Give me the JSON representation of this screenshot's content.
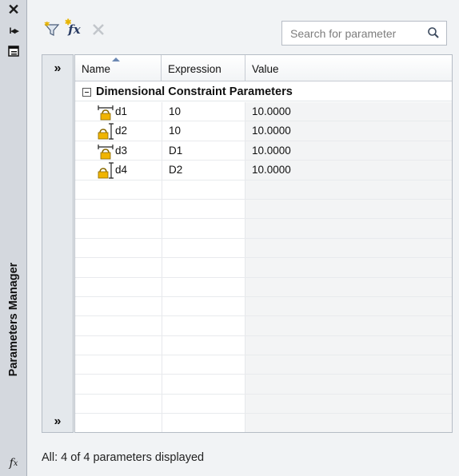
{
  "palette": {
    "title_text": "Parameters Manager"
  },
  "toolbar": {
    "filter_icon": "filter-icon",
    "fx_label": "fx",
    "delete_icon": "delete-icon",
    "search_placeholder": "Search for parameter"
  },
  "grid": {
    "columns": [
      "Name",
      "Expression",
      "Value"
    ],
    "group_label": "Dimensional Constraint Parameters",
    "rows": [
      {
        "name": "d1",
        "expression": "10",
        "value": "10.0000",
        "icon": "horizontal-dimension-lock-icon"
      },
      {
        "name": "d2",
        "expression": "10",
        "value": "10.0000",
        "icon": "vertical-dimension-lock-icon"
      },
      {
        "name": "d3",
        "expression": "D1",
        "value": "10.0000",
        "icon": "horizontal-dimension-lock-icon"
      },
      {
        "name": "d4",
        "expression": "D2",
        "value": "10.0000",
        "icon": "vertical-dimension-lock-icon"
      }
    ]
  },
  "status": "All: 4 of 4 parameters displayed",
  "colors": {
    "sidebar": "#d4d8de",
    "panel": "#f1f3f5",
    "lock": "#e0a800"
  }
}
